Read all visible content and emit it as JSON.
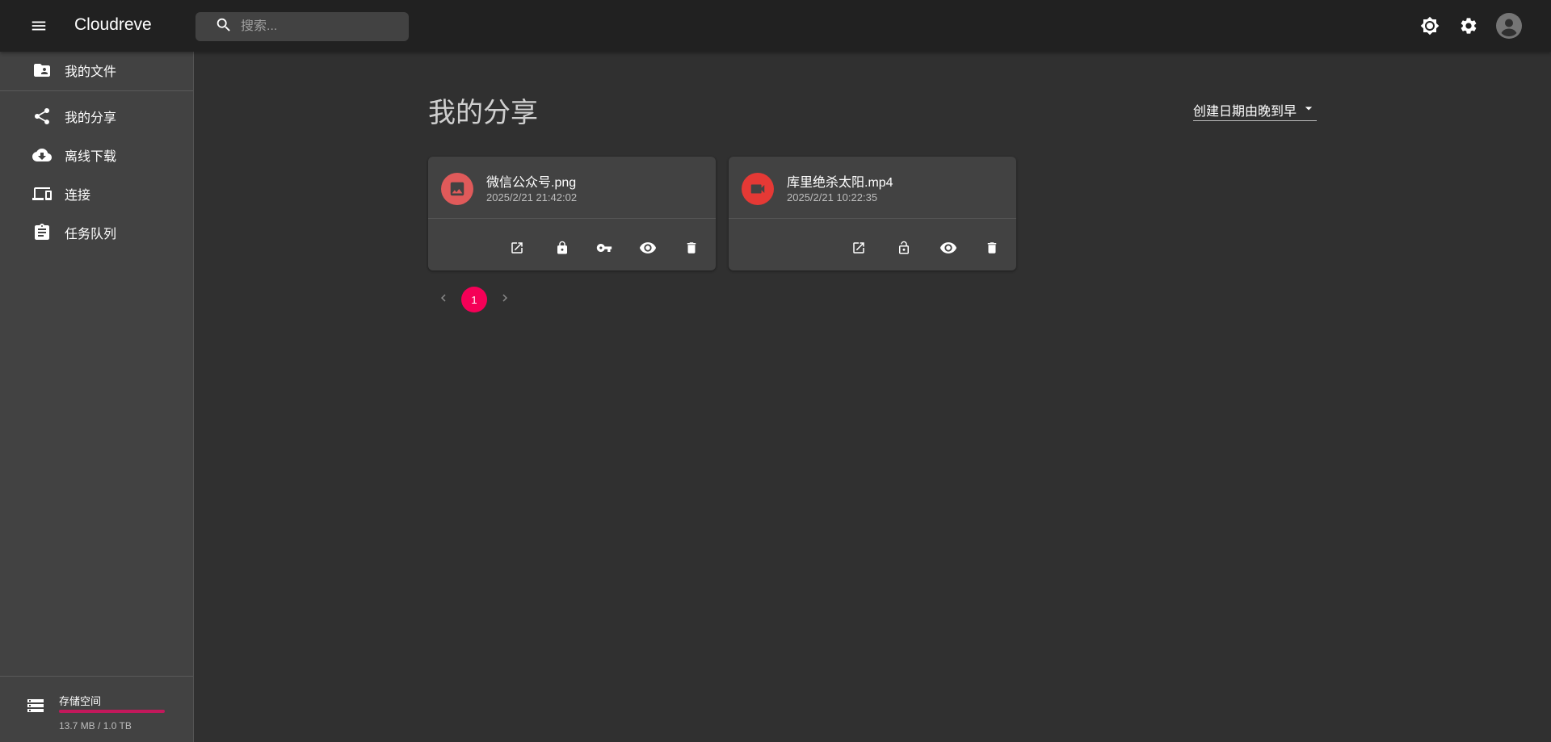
{
  "app": {
    "title": "Cloudreve"
  },
  "search": {
    "placeholder": "搜索..."
  },
  "sidebar": {
    "items": [
      {
        "label": "我的文件"
      },
      {
        "label": "我的分享"
      },
      {
        "label": "离线下载"
      },
      {
        "label": "连接"
      },
      {
        "label": "任务队列"
      }
    ],
    "storage": {
      "title": "存储空间",
      "text": "13.7 MB / 1.0 TB",
      "used_fraction": 1.0
    }
  },
  "main": {
    "title": "我的分享",
    "sort": {
      "selected": "创建日期由晚到早"
    },
    "shares": [
      {
        "name": "微信公众号.png",
        "date": "2025/2/21 21:42:02",
        "type": "image",
        "color": "#e05a5a"
      },
      {
        "name": "库里绝杀太阳.mp4",
        "date": "2025/2/21 10:22:35",
        "type": "video",
        "color": "#e53935"
      }
    ],
    "pagination": {
      "current": "1"
    }
  },
  "colors": {
    "accent": "#f50057",
    "appbar": "#212121",
    "sidebar": "#424242",
    "background": "#303030"
  }
}
